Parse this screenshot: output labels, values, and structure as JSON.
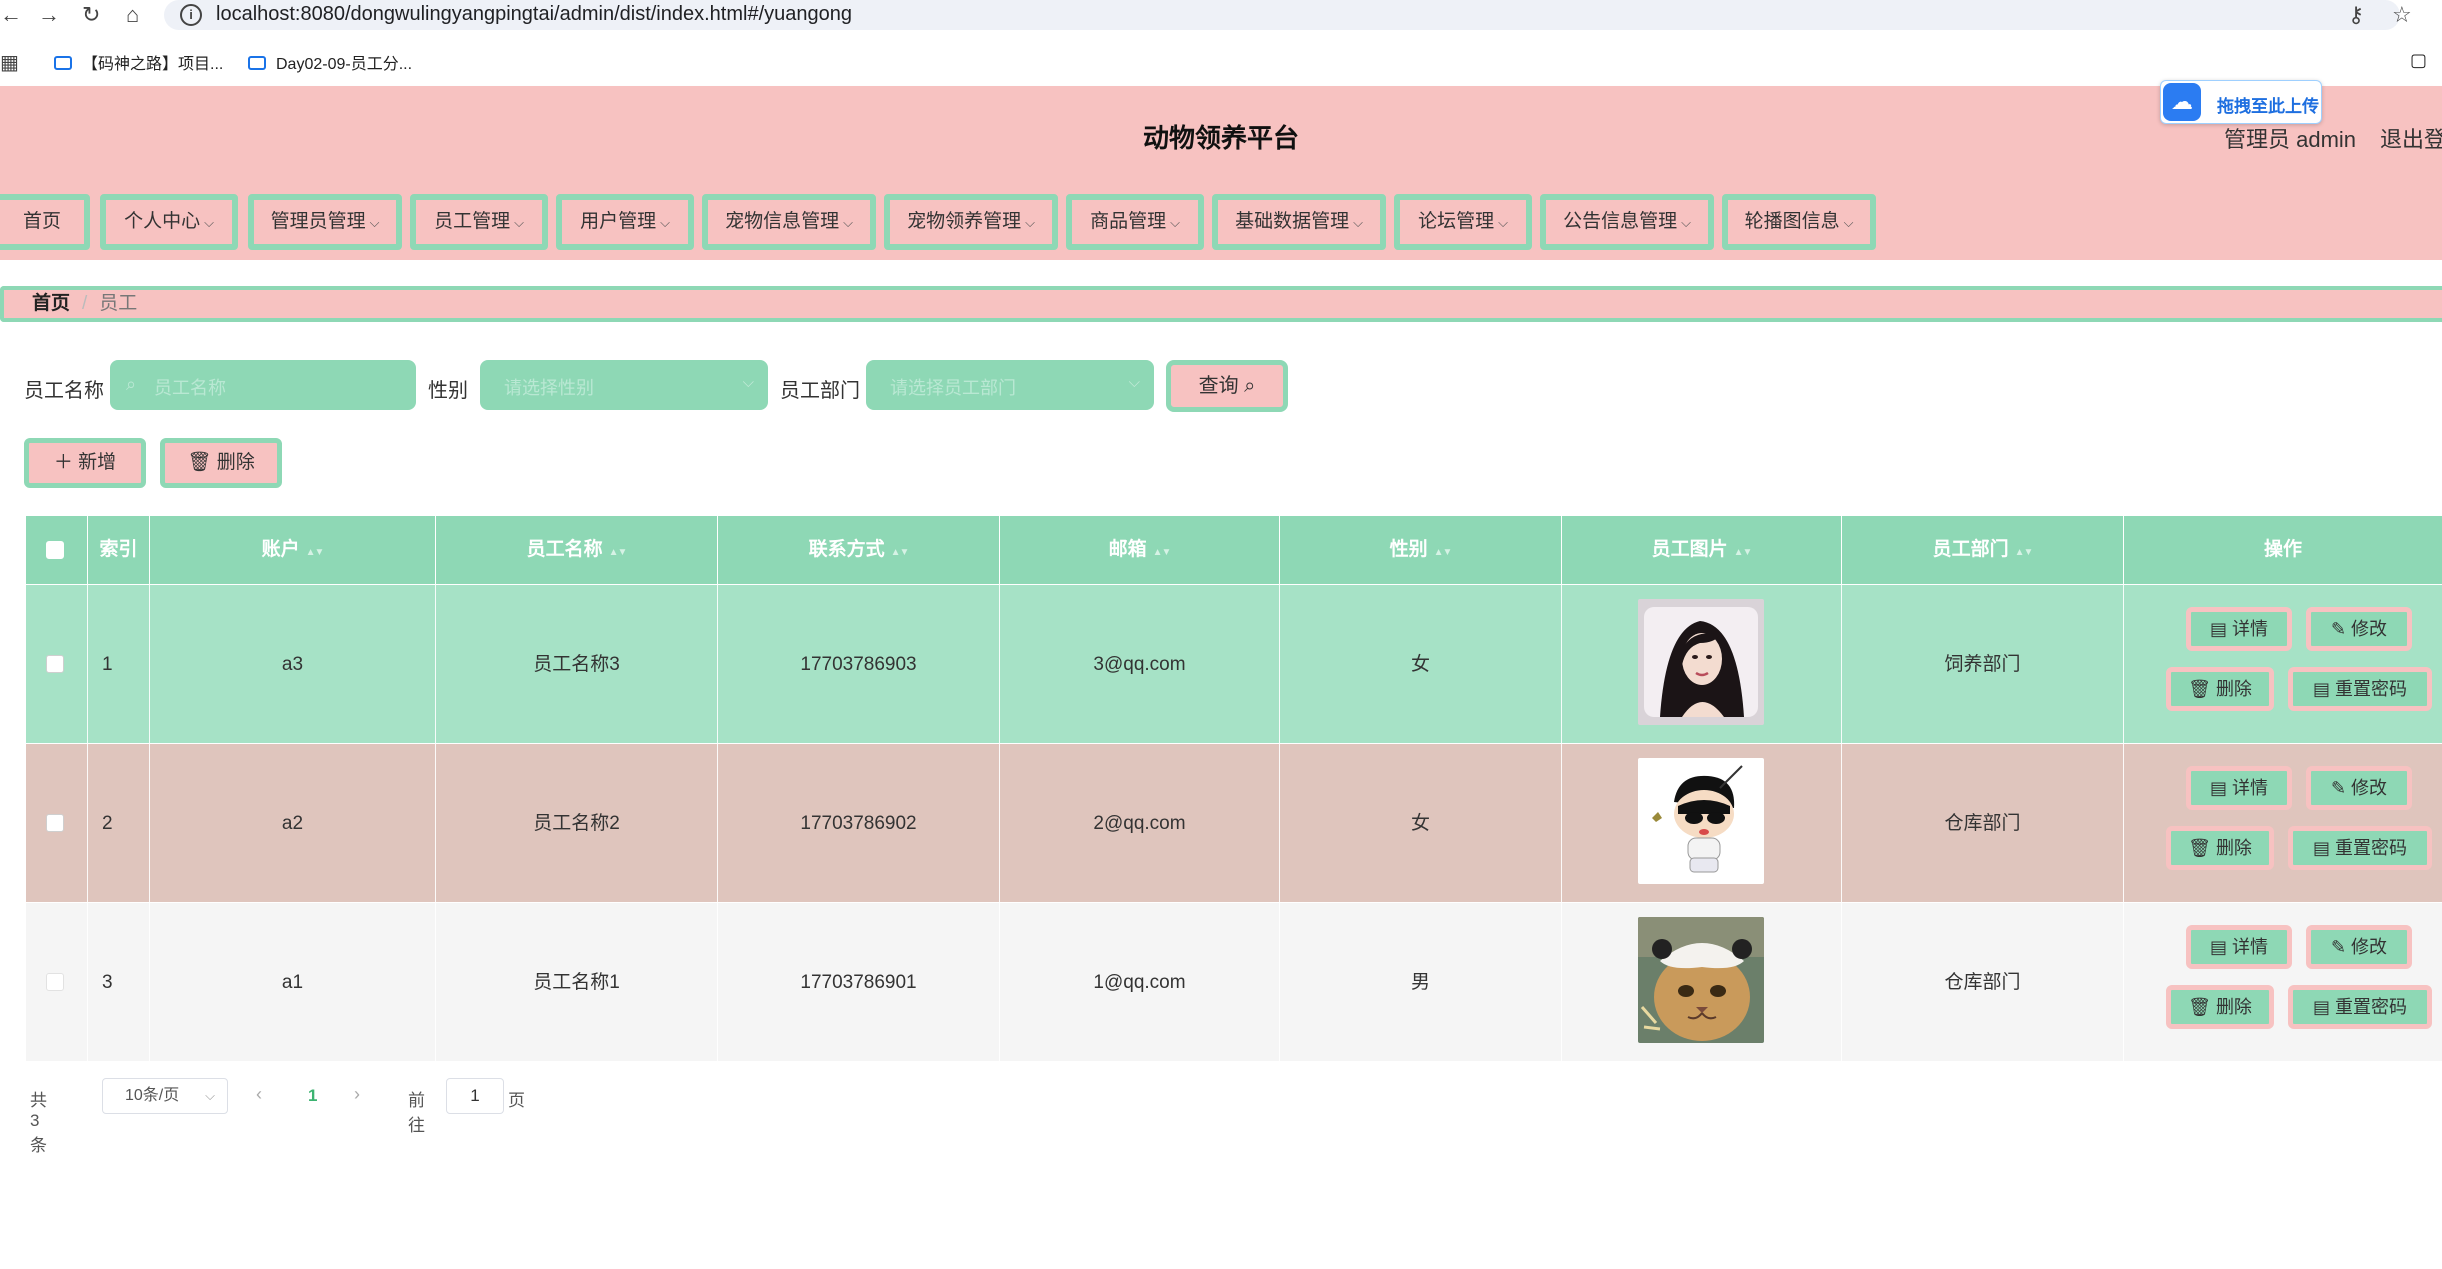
{
  "browser": {
    "url": "localhost:8080/dongwulingyangpingtai/admin/dist/index.html#/yuangong",
    "bookmarks": [
      "【码神之路】项目...",
      "Day02-09-员工分..."
    ]
  },
  "header": {
    "title": "动物领养平台",
    "admin": "管理员 admin",
    "logout": "退出登",
    "upload_badge": "拖拽至此上传"
  },
  "menu": [
    {
      "label": "首页",
      "dropdown": false
    },
    {
      "label": "个人中心",
      "dropdown": true
    },
    {
      "label": "管理员管理",
      "dropdown": true
    },
    {
      "label": "员工管理",
      "dropdown": true
    },
    {
      "label": "用户管理",
      "dropdown": true
    },
    {
      "label": "宠物信息管理",
      "dropdown": true
    },
    {
      "label": "宠物领养管理",
      "dropdown": true
    },
    {
      "label": "商品管理",
      "dropdown": true
    },
    {
      "label": "基础数据管理",
      "dropdown": true
    },
    {
      "label": "论坛管理",
      "dropdown": true
    },
    {
      "label": "公告信息管理",
      "dropdown": true
    },
    {
      "label": "轮播图信息",
      "dropdown": true
    }
  ],
  "breadcrumb": {
    "home": "首页",
    "current": "员工"
  },
  "search": {
    "name_label": "员工名称",
    "name_placeholder": "员工名称",
    "gender_label": "性别",
    "gender_placeholder": "请选择性别",
    "dept_label": "员工部门",
    "dept_placeholder": "请选择员工部门",
    "query_label": "查询"
  },
  "actions": {
    "add": "新增",
    "delete": "删除"
  },
  "table": {
    "columns": [
      "索引",
      "账户",
      "员工名称",
      "联系方式",
      "邮箱",
      "性别",
      "员工图片",
      "员工部门",
      "操作"
    ],
    "rows": [
      {
        "index": "1",
        "account": "a3",
        "name": "员工名称3",
        "phone": "17703786903",
        "email": "3@qq.com",
        "gender": "女",
        "dept": "饲养部门",
        "photo": "woman-portrait"
      },
      {
        "index": "2",
        "account": "a2",
        "name": "员工名称2",
        "phone": "17703786902",
        "email": "2@qq.com",
        "gender": "女",
        "dept": "仓库部门",
        "photo": "cartoon-boy"
      },
      {
        "index": "3",
        "account": "a1",
        "name": "员工名称1",
        "phone": "17703786901",
        "email": "1@qq.com",
        "gender": "男",
        "dept": "仓库部门",
        "photo": "cat-with-hat"
      }
    ],
    "row_colors": [
      "#a6e2c6",
      "#dfc5bd",
      "#f5f5f5"
    ],
    "ops": {
      "detail": "详情",
      "edit": "修改",
      "delete": "删除",
      "reset": "重置密码"
    }
  },
  "pagination": {
    "total": "共 3 条",
    "page_size": "10条/页",
    "current": "1",
    "goto_prefix": "前往",
    "goto_value": "1",
    "goto_suffix": "页"
  },
  "colors": {
    "pink": "#f7c2c1",
    "mint": "#8ed8b5"
  }
}
